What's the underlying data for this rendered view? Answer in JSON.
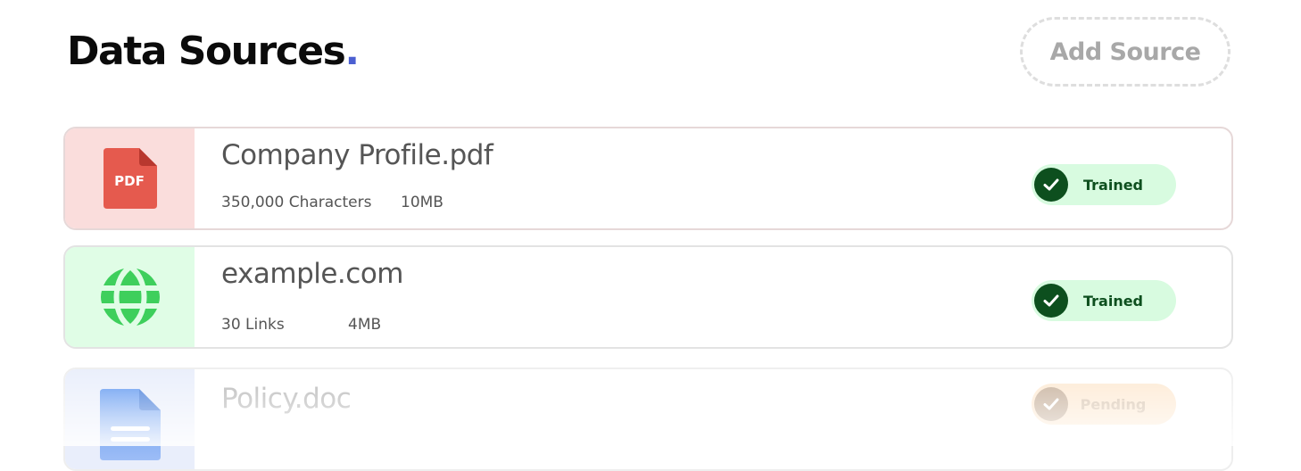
{
  "header": {
    "title": "Data Sources",
    "title_dot": ".",
    "add_button_label": "Add Source"
  },
  "colors": {
    "accent_dot": "#4b5fd1",
    "pdf_red": "#e55a4e",
    "web_green": "#3ecf5c",
    "doc_blue": "#4d8ff0",
    "trained_bg": "#d8fbe0",
    "trained_fg": "#0d4f1e",
    "pending_bg": "#fde9d2"
  },
  "sources": [
    {
      "name": "Company Profile.pdf",
      "icon": "pdf-file-icon",
      "icon_label": "PDF",
      "meta_count": "350,000 Characters",
      "meta_size": "10MB",
      "status": "Trained"
    },
    {
      "name": "example.com",
      "icon": "globe-icon",
      "meta_count": "30 Links",
      "meta_size": "4MB",
      "status": "Trained"
    },
    {
      "name": "Policy.doc",
      "icon": "doc-file-icon",
      "status": "Pending"
    }
  ]
}
